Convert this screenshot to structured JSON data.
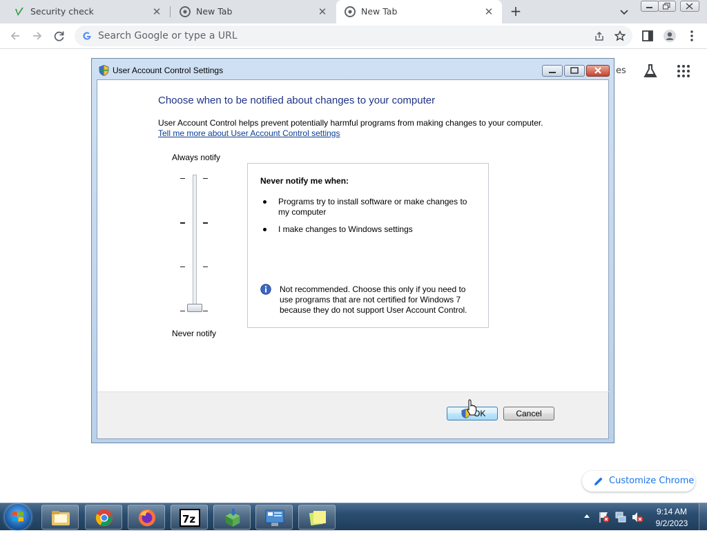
{
  "browser": {
    "tabs": [
      {
        "title": "Security check",
        "icon": "norton-icon",
        "active": false
      },
      {
        "title": "New Tab",
        "icon": "chrome-icon",
        "active": false
      },
      {
        "title": "New Tab",
        "icon": "chrome-icon",
        "active": true
      }
    ],
    "omnibox_placeholder": "Search Google or type a URL",
    "page_partial_text": "es",
    "customize_label": "Customize Chrome"
  },
  "dialog": {
    "title": "User Account Control Settings",
    "heading": "Choose when to be notified about changes to your computer",
    "description": "User Account Control helps prevent potentially harmful programs from making changes to your computer.",
    "learn_more": "Tell me more about User Account Control settings",
    "slider": {
      "top_label": "Always notify",
      "bottom_label": "Never notify",
      "levels": 4,
      "selected_level": 1
    },
    "info": {
      "heading": "Never notify me when:",
      "bullets": [
        "Programs try to install software or make changes to my computer",
        "I make changes to Windows settings"
      ],
      "note": "Not recommended. Choose this only if you need to use programs that are not certified for Windows 7 because they do not support User Account Control."
    },
    "ok_label": "OK",
    "cancel_label": "Cancel"
  },
  "taskbar": {
    "apps": [
      "explorer",
      "chrome",
      "firefox",
      "7-zip",
      "package-installer",
      "control-panel",
      "sticky-notes"
    ],
    "time": "9:14 AM",
    "date": "9/2/2023"
  },
  "colors": {
    "heading_blue": "#1e3287",
    "link_blue": "#0b3d91",
    "chrome_accent": "#1a73e8",
    "tabstrip_bg": "#dee1e6"
  }
}
